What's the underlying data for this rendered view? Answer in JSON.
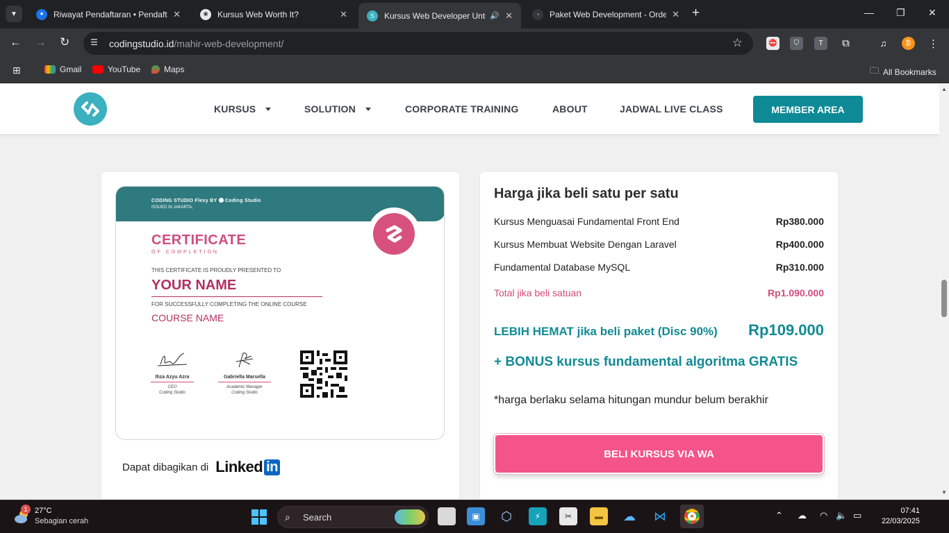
{
  "browser": {
    "tabs": [
      {
        "title": "Riwayat Pendaftaran • Pendaftaran",
        "active": false
      },
      {
        "title": "Kursus Web Worth It?",
        "active": false
      },
      {
        "title": "Kursus Web Developer Untuk Pemula",
        "active": true
      },
      {
        "title": "Paket Web Development - Order",
        "active": false
      }
    ],
    "url_host": "codingstudio.id",
    "url_path": "/mahir-web-development/",
    "bookmarks": [
      "Gmail",
      "YouTube",
      "Maps"
    ],
    "all_bookmarks": "All Bookmarks"
  },
  "site": {
    "nav": [
      {
        "label": "KURSUS",
        "dropdown": true
      },
      {
        "label": "SOLUTION",
        "dropdown": true
      },
      {
        "label": "CORPORATE TRAINING",
        "dropdown": false
      },
      {
        "label": "ABOUT",
        "dropdown": false
      },
      {
        "label": "JADWAL LIVE CLASS",
        "dropdown": false
      }
    ],
    "member_button": "MEMBER AREA",
    "accent": "#0e8a97",
    "pink": "#f4548a"
  },
  "certificate": {
    "brand": "CODING STUDIO Flexy BY",
    "brand_name": "Coding Studio",
    "issued": "ISSUED IN JAKARTA,",
    "title": "CERTIFICATE",
    "subtitle": "OF COMPLETION",
    "presented": "THIS CERTIFICATE IS PROUDLY PRESENTED TO",
    "name": "YOUR NAME",
    "for": "FOR SUCCESSFULLY COMPLETING THE ONLINE COURSE",
    "course": "COURSE NAME",
    "signers": [
      {
        "name": "Ihza Azyu Azra",
        "role1": "CEO",
        "role2": "Coding Studio"
      },
      {
        "name": "Gabriella Marsella",
        "role1": "Academic Manager",
        "role2": "Coding Studio"
      }
    ],
    "share_label": "Dapat dibagikan di",
    "share_brand": "Linked",
    "share_brand_in": "in"
  },
  "pricing": {
    "heading": "Harga jika beli satu per satu",
    "items": [
      {
        "name": "Kursus Menguasai Fundamental Front End",
        "price": "Rp380.000"
      },
      {
        "name": "Kursus Membuat Website Dengan Laravel",
        "price": "Rp400.000"
      },
      {
        "name": "Fundamental Database MySQL",
        "price": "Rp310.000"
      }
    ],
    "total_label": "Total jika beli satuan",
    "total_price": "Rp1.090.000",
    "save_label": "LEBIH HEMAT jika beli paket (Disc 90%)",
    "save_price": "Rp109.000",
    "bonus": "+ BONUS kursus fundamental algoritma GRATIS",
    "note": "*harga berlaku selama hitungan mundur belum berakhir",
    "buy_button": "BELI KURSUS VIA WA"
  },
  "taskbar": {
    "temperature": "27°C",
    "weather": "Sebagian cerah",
    "weather_badge": "1",
    "search": "Search",
    "time": "07:41",
    "date": "22/03/2025"
  }
}
